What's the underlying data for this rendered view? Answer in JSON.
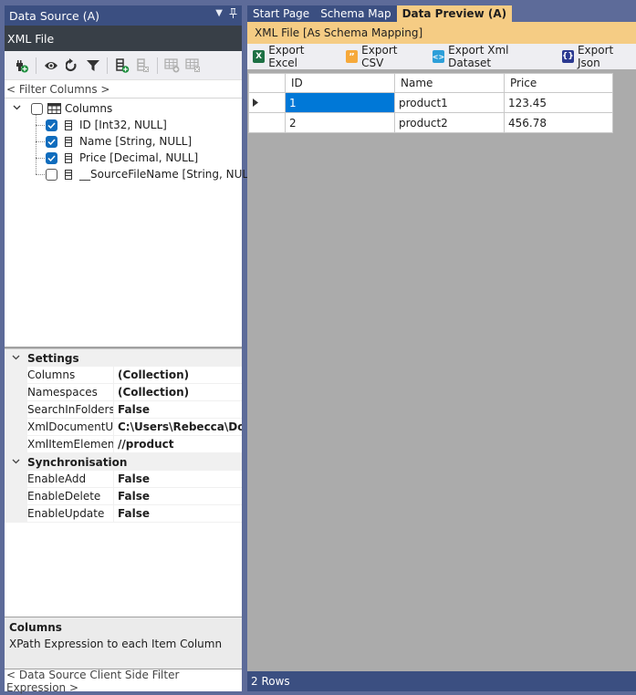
{
  "left_panel": {
    "title": "Data Source (A)",
    "subtitle": "XML File",
    "toolbar_icons": [
      "add-connection-icon",
      "preview-icon",
      "refresh-icon",
      "filter-icon",
      "add-column-icon",
      "remove-column-icon",
      "add-table-icon",
      "remove-table-icon"
    ],
    "filter_placeholder": "< Filter Columns >",
    "tree": {
      "root_label": "Columns",
      "root_checked": false,
      "columns": [
        {
          "label": "ID [Int32, NULL]",
          "checked": true
        },
        {
          "label": "Name [String, NULL]",
          "checked": true
        },
        {
          "label": "Price [Decimal, NULL]",
          "checked": true
        },
        {
          "label": "__SourceFileName [String, NULL]",
          "checked": false
        }
      ]
    },
    "properties": {
      "categories": [
        {
          "name": "Settings",
          "rows": [
            {
              "name": "Columns",
              "value": "(Collection)"
            },
            {
              "name": "Namespaces",
              "value": "(Collection)"
            },
            {
              "name": "SearchInFolders",
              "value": "False"
            },
            {
              "name": "XmlDocumentUr",
              "value": "C:\\Users\\Rebecca\\Documents"
            },
            {
              "name": "XmlItemElementX",
              "value": "//product"
            }
          ]
        },
        {
          "name": "Synchronisation",
          "rows": [
            {
              "name": "EnableAdd",
              "value": "False"
            },
            {
              "name": "EnableDelete",
              "value": "False"
            },
            {
              "name": "EnableUpdate",
              "value": "False"
            }
          ]
        }
      ]
    },
    "description": {
      "title": "Columns",
      "text": "XPath Expression to each Item Column"
    },
    "client_filter_placeholder": "< Data Source Client Side Filter Expression >"
  },
  "tabs": [
    {
      "label": "Start Page",
      "active": false
    },
    {
      "label": "Schema Map",
      "active": false
    },
    {
      "label": "Data Preview (A)",
      "active": true
    }
  ],
  "right_panel": {
    "doc_title": "XML File [As Schema Mapping]",
    "export_buttons": [
      {
        "label": "Export Excel",
        "icon": "excel-icon",
        "glyph": "X",
        "color": "#1d7044"
      },
      {
        "label": "Export CSV",
        "icon": "csv-icon",
        "glyph": "99",
        "color": "#f6a93b"
      },
      {
        "label": "Export Xml Dataset",
        "icon": "xml-icon",
        "glyph": "<>",
        "color": "#2d9fd9"
      },
      {
        "label": "Export Json",
        "icon": "json-icon",
        "glyph": "{}",
        "color": "#2b3990"
      }
    ],
    "grid": {
      "columns": [
        "ID",
        "Name",
        "Price"
      ],
      "rows": [
        [
          "1",
          "product1",
          "123.45"
        ],
        [
          "2",
          "product2",
          "456.78"
        ]
      ],
      "selected_row": 0
    },
    "status": "2 Rows"
  },
  "colors": {
    "accent": "#3b4f81",
    "tab_active": "#f5cc84",
    "selection": "#0078d7",
    "background": "#5d6b99"
  }
}
